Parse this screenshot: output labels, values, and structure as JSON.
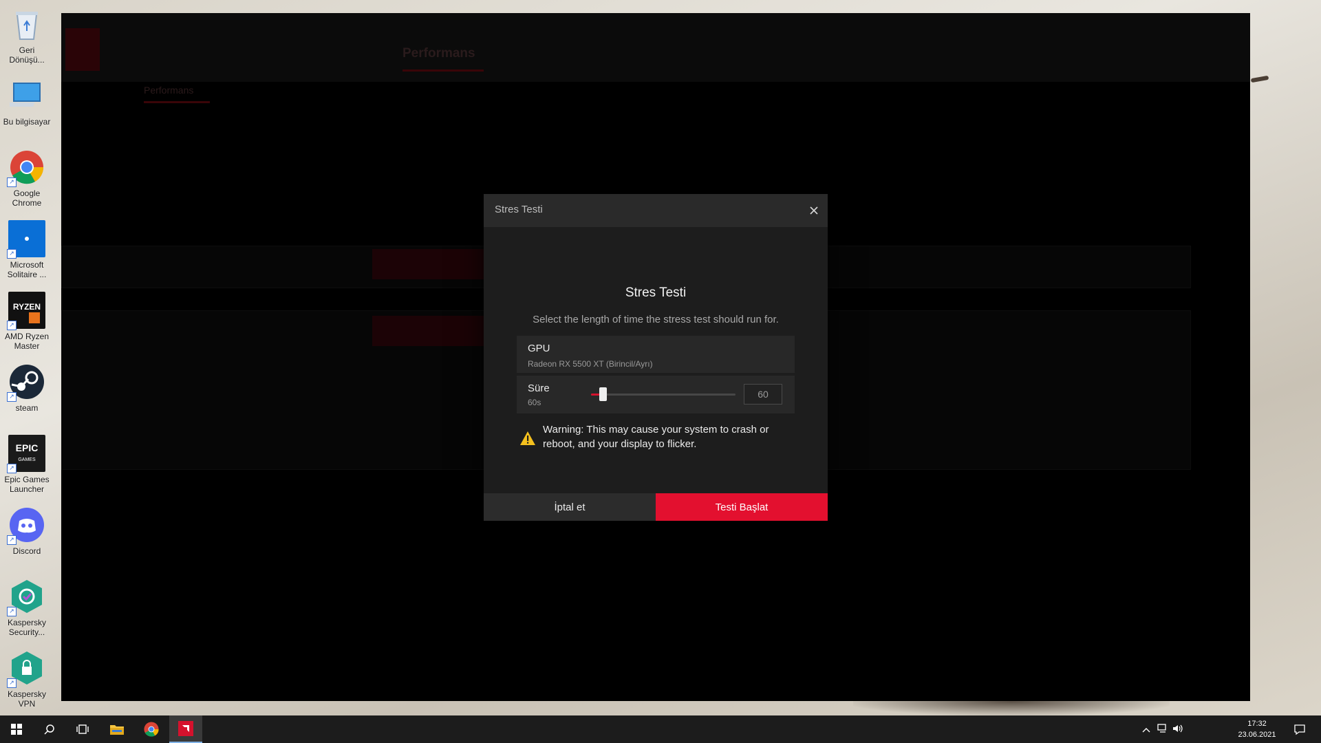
{
  "desktop": {
    "icons": [
      {
        "name": "recycle-bin",
        "label": "Geri Dönüşü..."
      },
      {
        "name": "this-pc",
        "label": "Bu bilgisayar"
      },
      {
        "name": "google-chrome",
        "label": "Google Chrome"
      },
      {
        "name": "microsoft-solitaire",
        "label": "Microsoft Solitaire ..."
      },
      {
        "name": "amd-ryzen-master",
        "label": "AMD Ryzen Master"
      },
      {
        "name": "steam",
        "label": "steam"
      },
      {
        "name": "epic-games-launcher",
        "label": "Epic Games Launcher"
      },
      {
        "name": "discord",
        "label": "Discord"
      },
      {
        "name": "kaspersky-security",
        "label": "Kaspersky Security..."
      },
      {
        "name": "kaspersky-vpn",
        "label": "Kaspersky VPN"
      }
    ]
  },
  "app": {
    "nav_active": "Performans",
    "sub_active": "Performans"
  },
  "dialog": {
    "window_title": "Stres Testi",
    "heading": "Stres Testi",
    "description": "Select the length of time the stress test should run for.",
    "gpu_label": "GPU",
    "gpu_name": "Radeon RX 5500 XT (Birincil/Ayrı)",
    "duration_label": "Süre",
    "duration_sub": "60s",
    "duration_value": "60",
    "slider_fraction": 0.08,
    "warning": "Warning: This may cause your system to crash or reboot, and your display to flicker.",
    "cancel_label": "İptal et",
    "start_label": "Testi Başlat",
    "accent_color": "#e3102f"
  },
  "taskbar": {
    "time": "17:32",
    "date": "23.06.2021"
  }
}
